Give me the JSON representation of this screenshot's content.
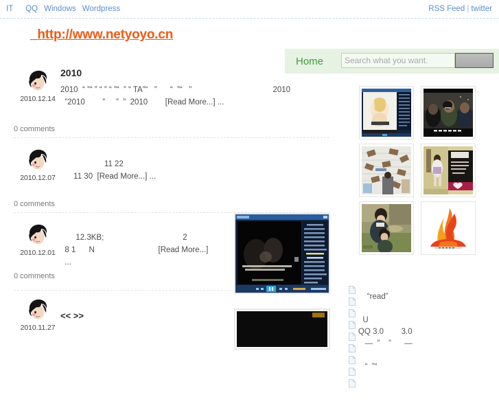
{
  "topbar": {
    "nav": [
      {
        "label": "IT",
        "name": "topnav-it"
      },
      {
        "label": "QQ",
        "name": "topnav-qq"
      },
      {
        "label": "Windows",
        "name": "topnav-windows"
      },
      {
        "label": "Wordpress",
        "name": "topnav-wordpress"
      }
    ],
    "rss_label": "RSS Feed",
    "separator": "|",
    "twitter_label": "twitter"
  },
  "header": {
    "site_title": "_http://www.netyoyo.cn",
    "title_color": "#f05a14",
    "home_label": "Home",
    "search_placeholder": "Search what you want.",
    "search_value": "",
    "search_button_label": ""
  },
  "posts": [
    {
      "date": "2010.12.14",
      "title": "2010",
      "excerpt_line1": "2010  “ ”“ ” “ ” “ ”“  ” “ TA”“   ”      “  ”“   ”                                     2010",
      "excerpt_line2": "  ”2010        ”     ”  ”  2010        ",
      "read_more": "[Read More...]",
      "trailing": " ...",
      "comments": "0 comments",
      "thumb": null
    },
    {
      "date": "2010.12.07",
      "title": "",
      "excerpt_line1": "                    11 22",
      "excerpt_line2": "      11 30  ",
      "read_more": "[Read More...]",
      "trailing": " ...",
      "comments": "0 comments",
      "thumb": null
    },
    {
      "date": "2010.12.01",
      "title": "",
      "excerpt_line1": "       12.3KB;                                    2",
      "excerpt_line2": "  8 1      N                             ",
      "read_more": "[Read More...]",
      "trailing": "",
      "excerpt_line3": "  ...",
      "comments": "0 comments",
      "thumb": "media-player-screenshot"
    },
    {
      "date": "2010.11.27",
      "title": "<<   >>",
      "excerpt_line1": "",
      "excerpt_line2": "",
      "read_more": "",
      "trailing": "",
      "comments": "",
      "thumb": "dark-video-screenshot"
    }
  ],
  "sidebar": {
    "thumbnails": [
      {
        "name": "thumb-media-player-woman",
        "alt": "media player with blonde woman"
      },
      {
        "name": "thumb-movie-scene-night",
        "alt": "dark movie scene with subtitle"
      },
      {
        "name": "thumb-flying-books",
        "alt": "flying books over person at window"
      },
      {
        "name": "thumb-girl-poster",
        "alt": "girl in dress with dark text poster"
      },
      {
        "name": "thumb-vintage-children",
        "alt": "vintage painting of two children"
      },
      {
        "name": "thumb-flame-logo",
        "alt": "orange flame torch logo"
      }
    ],
    "recent_items": [
      {
        "label": "  "
      },
      {
        "label": "  "
      },
      {
        "label": "    “read”"
      },
      {
        "label": "  "
      },
      {
        "label": "  U"
      },
      {
        "label": "QQ 3.0        3.0"
      },
      {
        "label": "   —  ”    ”      —"
      },
      {
        "label": "  "
      },
      {
        "label": "   “  ”“"
      }
    ]
  }
}
